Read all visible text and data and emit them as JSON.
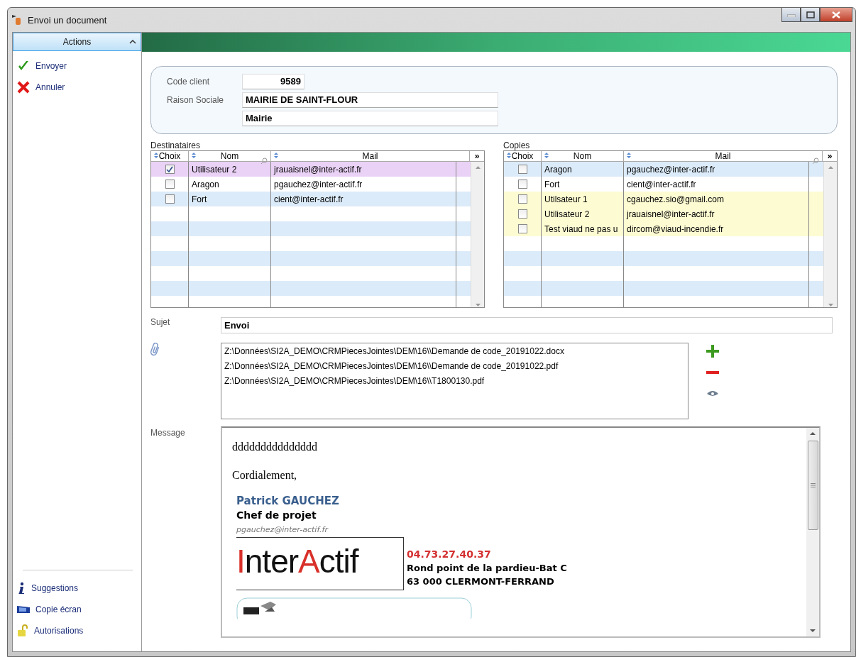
{
  "window": {
    "title": "Envoi un document"
  },
  "sidebar": {
    "header": "Actions",
    "expanded": true,
    "actions": [
      {
        "label": "Envoyer",
        "kind": "check"
      },
      {
        "label": "Annuler",
        "kind": "cross"
      }
    ],
    "footer": [
      {
        "label": "Suggestions",
        "kind": "info"
      },
      {
        "label": "Copie écran",
        "kind": "screen"
      },
      {
        "label": "Autorisations",
        "kind": "lock"
      }
    ]
  },
  "client": {
    "code_label": "Code client",
    "code": "9589",
    "raison_label": "Raison Sociale",
    "raison": "MAIRIE DE SAINT-FLOUR",
    "type": "Mairie"
  },
  "destinataires": {
    "title": "Destinataires",
    "columns": [
      "Choix",
      "Nom",
      "Mail"
    ],
    "more": "»",
    "rows": [
      {
        "nom": "Utilisateur 2",
        "mail": "jrauaisnel@inter-actif.fr",
        "checked": true,
        "color": "#ead2f6"
      },
      {
        "nom": "Aragon",
        "mail": "pgauchez@inter-actif.fr",
        "checked": false,
        "color": "#ffffff"
      },
      {
        "nom": "Fort",
        "mail": "cient@inter-actif.fr",
        "checked": false,
        "color": "#dcebf9"
      }
    ]
  },
  "copies": {
    "title": "Copies",
    "columns": [
      "Choix",
      "Nom",
      "Mail"
    ],
    "more": "»",
    "rows": [
      {
        "nom": "Aragon",
        "mail": "pgauchez@inter-actif.fr",
        "checked": false,
        "color": "#dcebf9"
      },
      {
        "nom": "Fort",
        "mail": "cient@inter-actif.fr",
        "checked": false,
        "color": "#ffffff"
      },
      {
        "nom": "Utilsateur 1",
        "mail": "cgauchez.sio@gmail.com",
        "checked": false,
        "color": "#fdfbd2"
      },
      {
        "nom": "Utilisateur 2",
        "mail": "jrauaisnel@inter-actif.fr",
        "checked": false,
        "color": "#fdfbd2"
      },
      {
        "nom": "Test viaud ne pas u",
        "mail": "dircom@viaud-incendie.fr",
        "checked": false,
        "color": "#fdfbd2"
      }
    ]
  },
  "sujet": {
    "label": "Sujet",
    "value": "Envoi"
  },
  "attachments": [
    "Z:\\Données\\SI2A_DEMO\\CRMPiecesJointes\\DEM\\16\\\\Demande de code_20191022.docx",
    "Z:\\Données\\SI2A_DEMO\\CRMPiecesJointes\\DEM\\16\\\\Demande de code_20191022.pdf",
    "Z:\\Données\\SI2A_DEMO\\CRMPiecesJointes\\DEM\\16\\\\T1800130.pdf"
  ],
  "message": {
    "label": "Message",
    "lines": [
      "ddddddddddddddd",
      "Cordialement,"
    ],
    "signature": {
      "name": "Patrick GAUCHEZ",
      "role": "Chef de projet",
      "email": "pgauchez@inter-actif.fr",
      "logo": [
        {
          "text": "I",
          "color": "#d9302a"
        },
        {
          "text": "nter",
          "color": "#111111"
        },
        {
          "text": "A",
          "color": "#d9302a"
        },
        {
          "text": "ctif",
          "color": "#111111"
        }
      ],
      "phone": "04.73.27.40.37",
      "address": [
        "Rond point de la pardieu-Bat C",
        "63 000 CLERMONT-FERRAND"
      ]
    }
  }
}
